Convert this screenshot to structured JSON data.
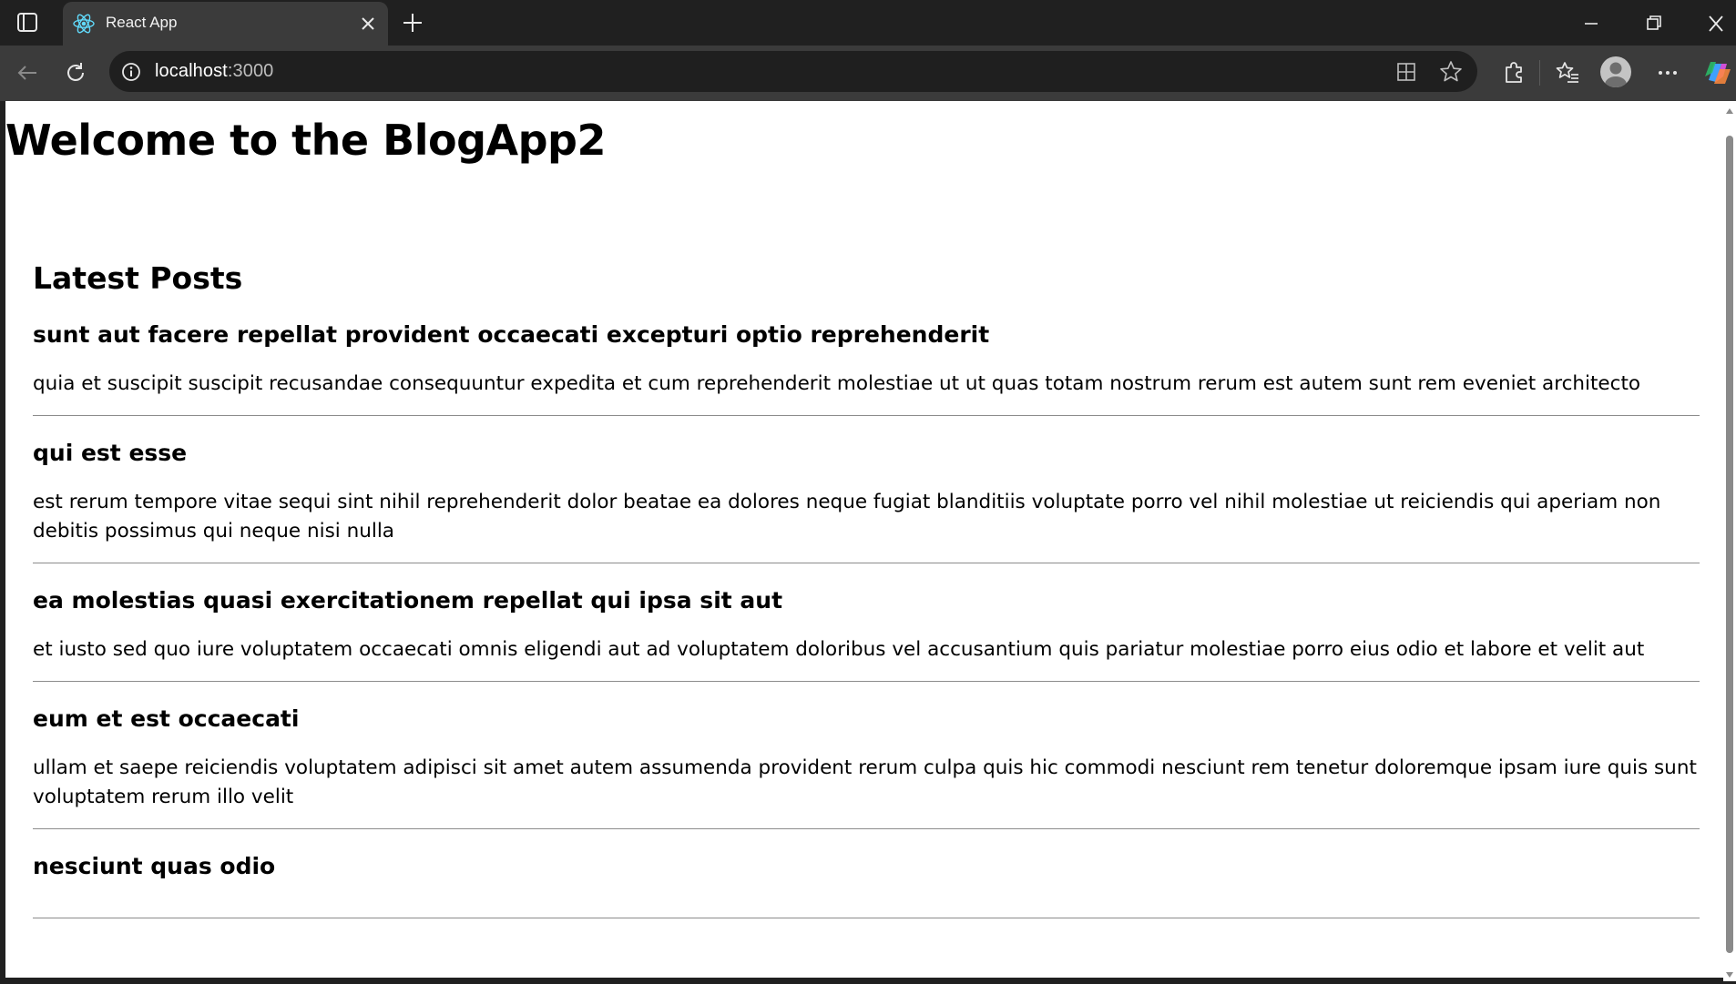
{
  "browser": {
    "tab": {
      "title": "React App"
    },
    "address": {
      "host": "localhost",
      "port": ":3000"
    }
  },
  "page": {
    "heading": "Welcome to the BlogApp2",
    "section_title": "Latest Posts",
    "posts": [
      {
        "title": "sunt aut facere repellat provident occaecati excepturi optio reprehenderit",
        "body": "quia et suscipit suscipit recusandae consequuntur expedita et cum reprehenderit molestiae ut ut quas totam nostrum rerum est autem sunt rem eveniet architecto"
      },
      {
        "title": "qui est esse",
        "body": "est rerum tempore vitae sequi sint nihil reprehenderit dolor beatae ea dolores neque fugiat blanditiis voluptate porro vel nihil molestiae ut reiciendis qui aperiam non debitis possimus qui neque nisi nulla"
      },
      {
        "title": "ea molestias quasi exercitationem repellat qui ipsa sit aut",
        "body": "et iusto sed quo iure voluptatem occaecati omnis eligendi aut ad voluptatem doloribus vel accusantium quis pariatur molestiae porro eius odio et labore et velit aut"
      },
      {
        "title": "eum et est occaecati",
        "body": "ullam et saepe reiciendis voluptatem adipisci sit amet autem assumenda provident rerum culpa quis hic commodi nesciunt rem tenetur doloremque ipsam iure quis sunt voluptatem rerum illo velit"
      },
      {
        "title": "nesciunt quas odio",
        "body": ""
      }
    ]
  }
}
